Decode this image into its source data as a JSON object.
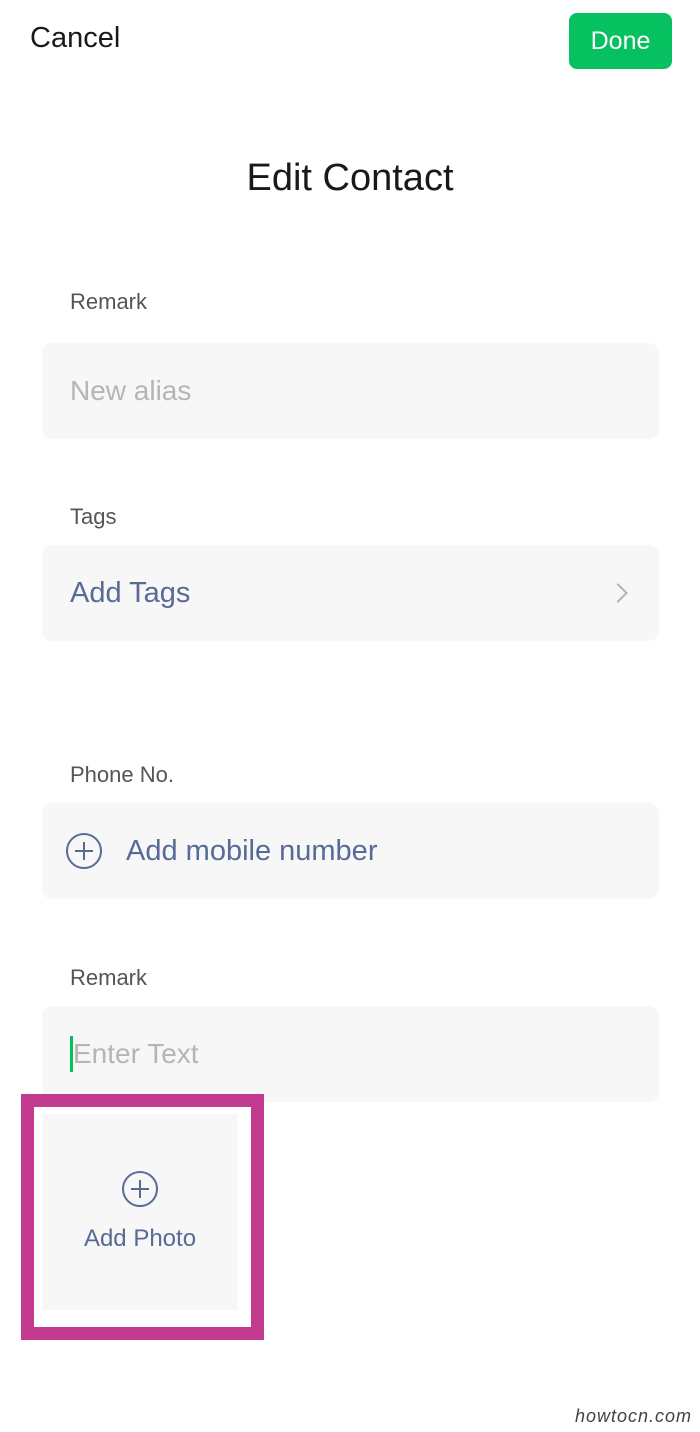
{
  "header": {
    "cancel_label": "Cancel",
    "done_label": "Done",
    "title": "Edit Contact"
  },
  "remark": {
    "label": "Remark",
    "placeholder": "New alias"
  },
  "tags": {
    "label": "Tags",
    "value": "Add Tags"
  },
  "phone": {
    "label": "Phone No.",
    "add_label": "Add mobile number"
  },
  "description": {
    "label": "Remark",
    "placeholder": "Enter Text"
  },
  "photo": {
    "add_label": "Add Photo"
  },
  "watermark": "howtocn.com",
  "colors": {
    "accent": "#07c160",
    "link": "#576b95",
    "highlight": "#c33b8f"
  }
}
